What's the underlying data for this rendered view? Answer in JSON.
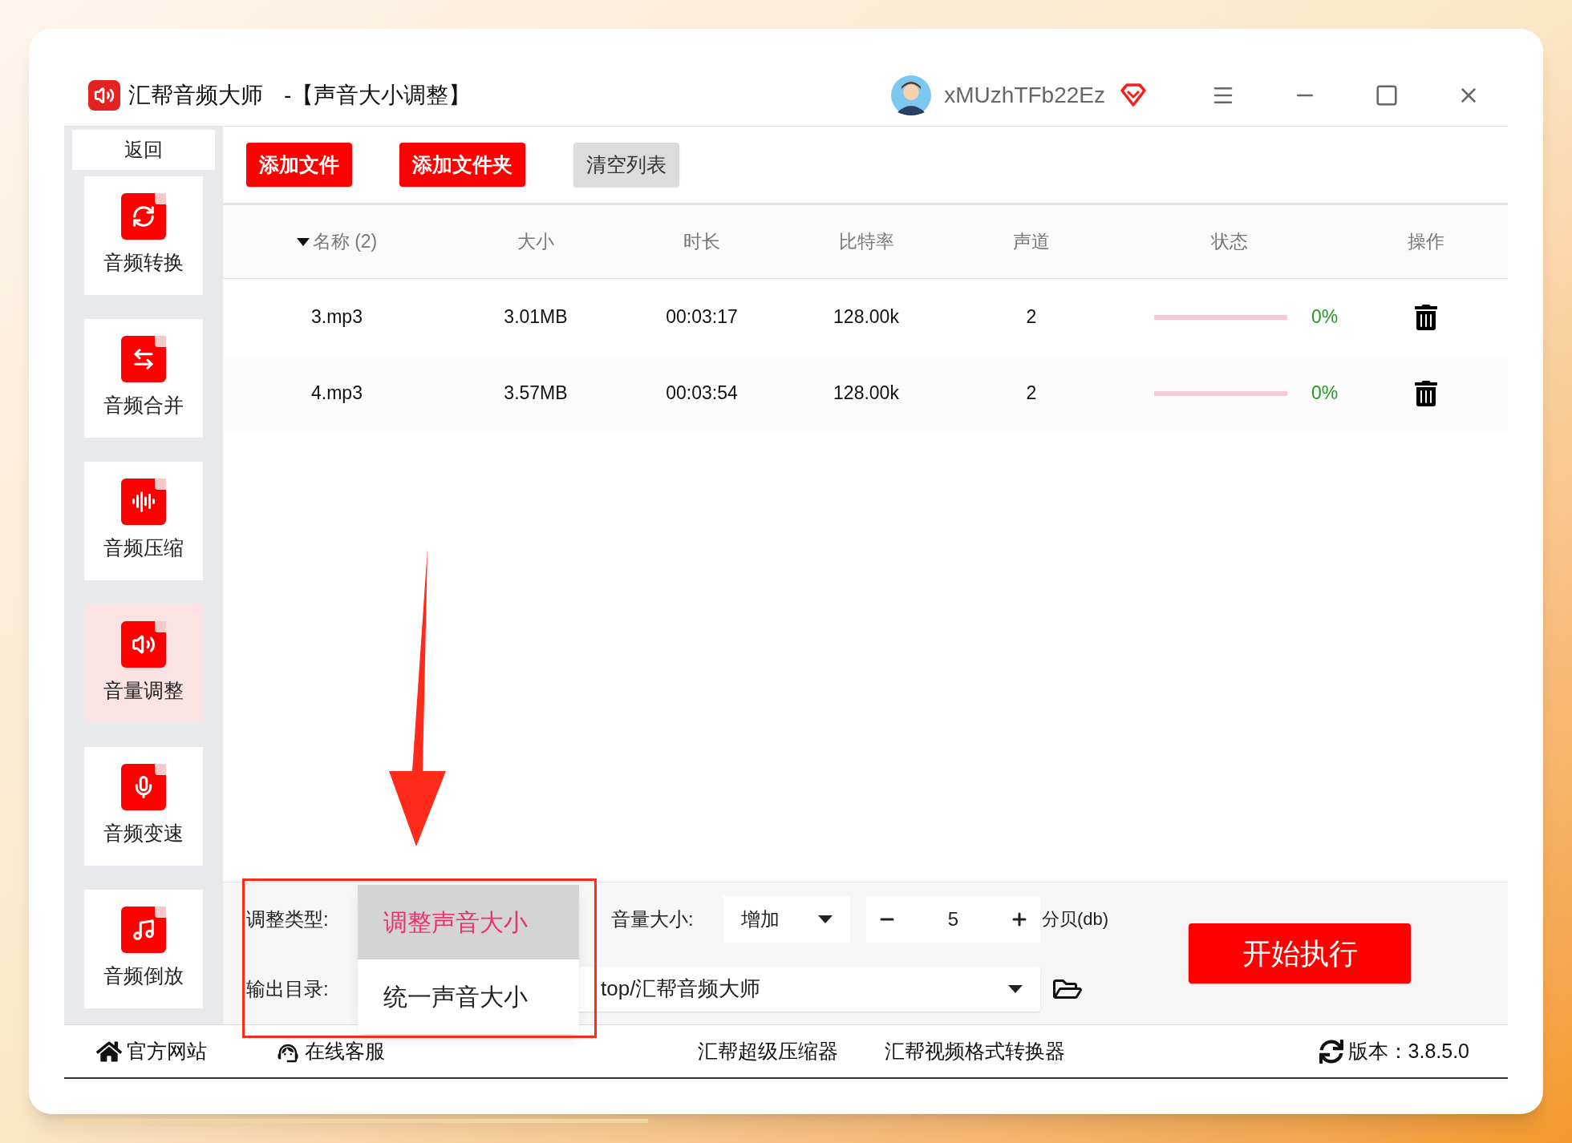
{
  "window": {
    "title": "汇帮音频大师",
    "subtitle": "-【声音大小调整】"
  },
  "user": {
    "name": "xMUzhTFb22Ez"
  },
  "sidebar": {
    "back": "返回",
    "items": [
      {
        "label": "音频转换",
        "selected": false
      },
      {
        "label": "音频合并",
        "selected": false
      },
      {
        "label": "音频压缩",
        "selected": false
      },
      {
        "label": "音量调整",
        "selected": true
      },
      {
        "label": "音频变速",
        "selected": false
      },
      {
        "label": "音频倒放",
        "selected": false
      }
    ]
  },
  "toolbar": {
    "buttons": [
      {
        "label": "添加文件",
        "kind": "primary"
      },
      {
        "label": "添加文件夹",
        "kind": "primary"
      },
      {
        "label": "清空列表",
        "kind": "secondary"
      }
    ]
  },
  "table": {
    "columns": [
      {
        "label": "名称 (2)",
        "sorted": true
      },
      {
        "label": "大小",
        "sorted": false
      },
      {
        "label": "时长",
        "sorted": false
      },
      {
        "label": "比特率",
        "sorted": false
      },
      {
        "label": "声道",
        "sorted": false
      },
      {
        "label": "状态",
        "sorted": false
      },
      {
        "label": "操作",
        "sorted": false
      }
    ],
    "rows": [
      {
        "name": "3.mp3",
        "size": "3.01MB",
        "duration": "00:03:17",
        "bitrate": "128.00k",
        "channels": "2",
        "level": 0,
        "progress": "0%"
      },
      {
        "name": "4.mp3",
        "size": "3.57MB",
        "duration": "00:03:54",
        "bitrate": "128.00k",
        "channels": "2",
        "level": 0,
        "progress": "0%"
      }
    ]
  },
  "settings": {
    "adjust_type_label": "调整类型:",
    "adjust_type_menu": [
      {
        "label": "调整声音大小",
        "selected": true
      },
      {
        "label": "统一声音大小",
        "selected": false
      }
    ],
    "volume_label": "音量大小:",
    "volume_mode": "增加",
    "volume_value": "5",
    "unit": "分贝(db)",
    "output_label": "输出目录:",
    "output_dir": "top/汇帮音频大师",
    "start": "开始执行"
  },
  "footer": {
    "links": [
      "官方网站",
      "在线客服"
    ],
    "products": [
      "汇帮超级压缩器",
      "汇帮视频格式转换器"
    ],
    "version": "版本：3.8.5.0"
  }
}
